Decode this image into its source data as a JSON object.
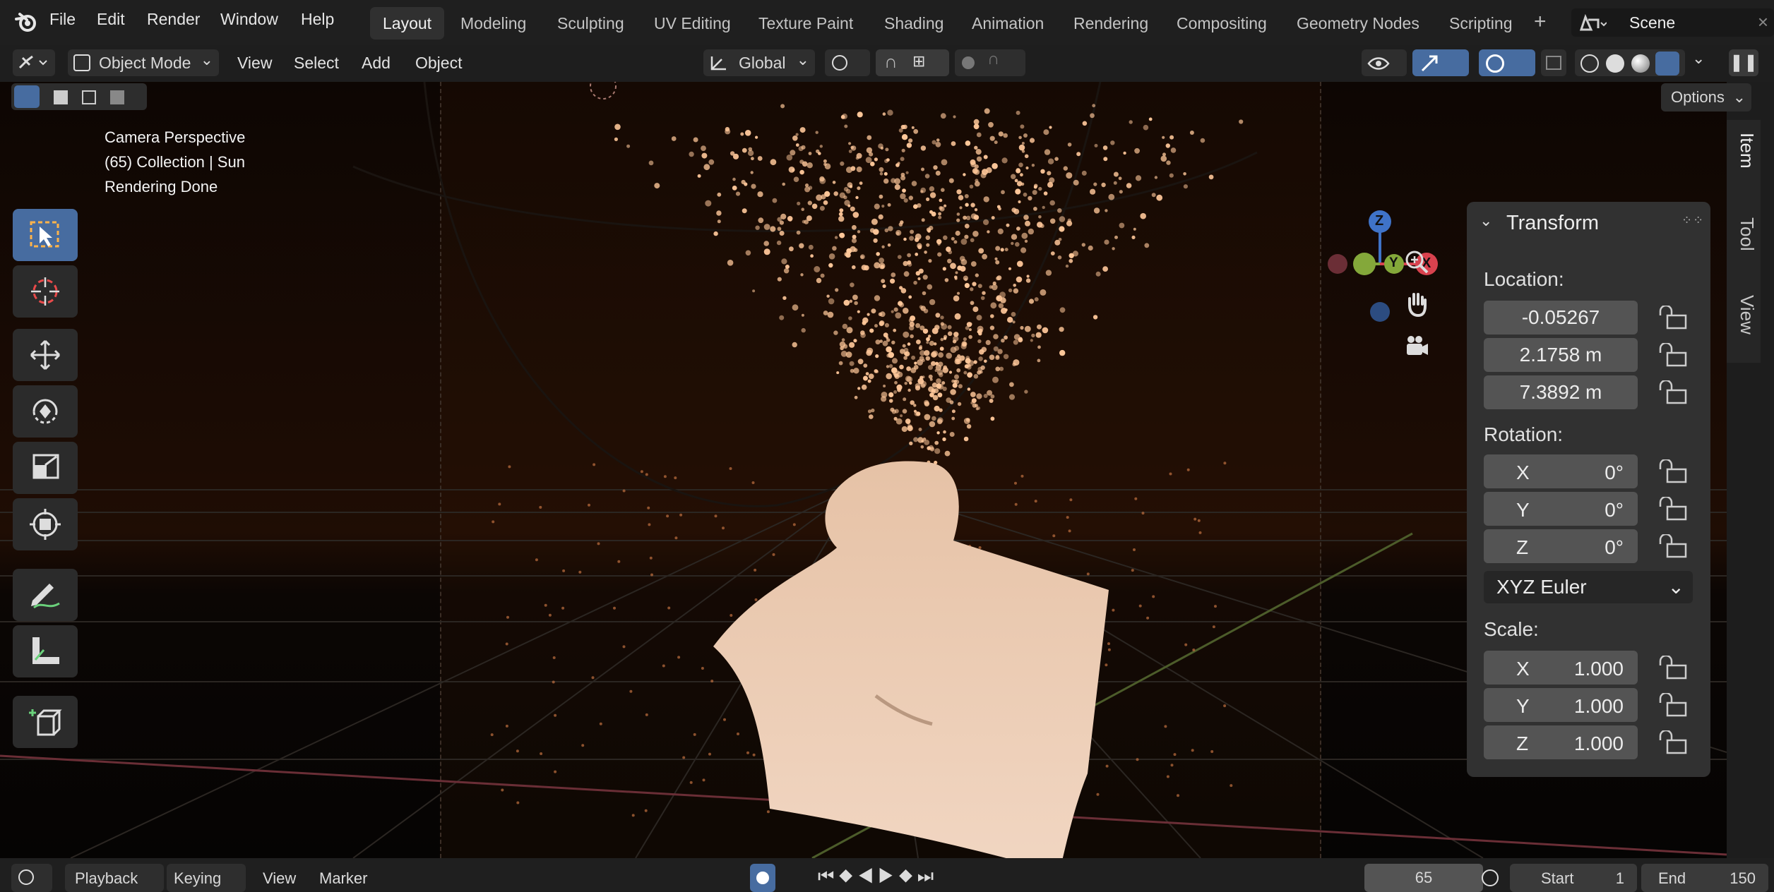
{
  "app": {
    "logo_icon": "blender-logo-icon"
  },
  "menu": [
    "File",
    "Edit",
    "Render",
    "Window",
    "Help"
  ],
  "workspace_tabs": [
    "Layout",
    "Modeling",
    "Sculpting",
    "UV Editing",
    "Texture Paint",
    "Shading",
    "Animation",
    "Rendering",
    "Compositing",
    "Geometry Nodes",
    "Scripting"
  ],
  "active_workspace": "Layout",
  "scene_name": "Scene",
  "header": {
    "mode": "Object Mode",
    "view": "View",
    "select": "Select",
    "add": "Add",
    "object": "Object",
    "orientation": "Global",
    "options": "Options"
  },
  "viewport_overlay": {
    "line1": "Camera Perspective",
    "line2": "(65) Collection | Sun",
    "line3": "Rendering Done"
  },
  "gizmo": {
    "z": "Z",
    "y": "Y",
    "x": "X"
  },
  "npanel": {
    "title": "Transform",
    "location_label": "Location:",
    "location": [
      "-0.05267",
      "2.1758 m",
      "7.3892 m"
    ],
    "rotation_label": "Rotation:",
    "rotation": [
      {
        "axis": "X",
        "value": "0°"
      },
      {
        "axis": "Y",
        "value": "0°"
      },
      {
        "axis": "Z",
        "value": "0°"
      }
    ],
    "rotation_mode": "XYZ Euler",
    "scale_label": "Scale:",
    "scale": [
      {
        "axis": "X",
        "value": "1.000"
      },
      {
        "axis": "Y",
        "value": "1.000"
      },
      {
        "axis": "Z",
        "value": "1.000"
      }
    ],
    "tabs": [
      "Item",
      "Tool",
      "View"
    ]
  },
  "timeline": {
    "playback": "Playback",
    "keying": "Keying",
    "view": "View",
    "marker": "Marker",
    "current_frame": "65",
    "start_label": "Start",
    "start": "1",
    "end_label": "End",
    "end": "150"
  },
  "colors": {
    "accent": "#476ca0",
    "particles": "#ffc89a",
    "bust": "#e8c9b1",
    "x_axis": "#d8424e",
    "y_axis": "#84a83a",
    "z_axis": "#3f73c8"
  }
}
